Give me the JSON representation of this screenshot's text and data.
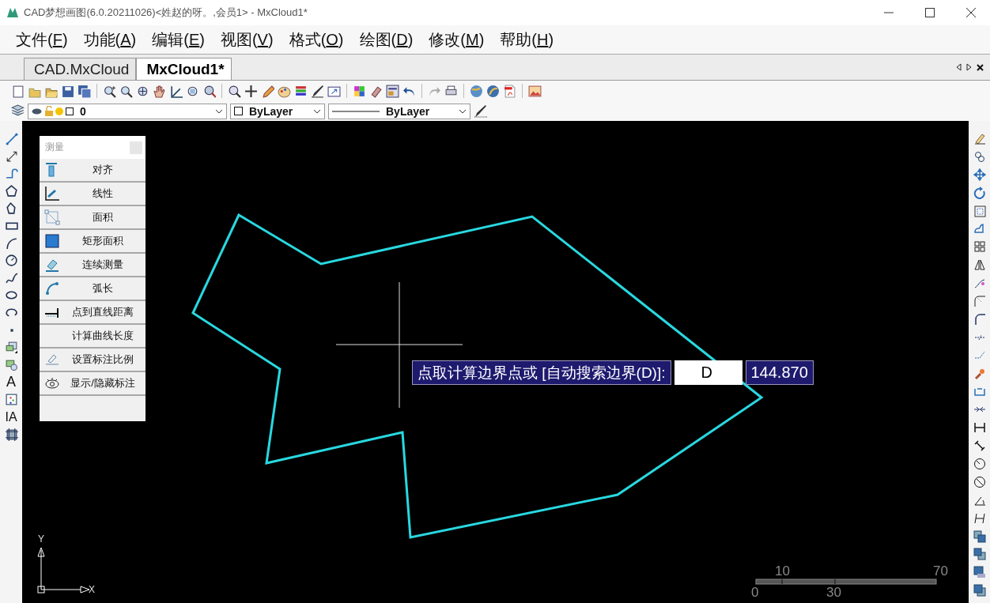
{
  "window": {
    "title": "CAD梦想画图(6.0.20211026)<姓赵的呀。,会员1> - MxCloud1*"
  },
  "menu": [
    {
      "before": "文件(",
      "key": "F",
      "after": ")"
    },
    {
      "before": "功能(",
      "key": "A",
      "after": ")"
    },
    {
      "before": "编辑(",
      "key": "E",
      "after": ")"
    },
    {
      "before": "视图(",
      "key": "V",
      "after": ")"
    },
    {
      "before": "格式(",
      "key": "O",
      "after": ")"
    },
    {
      "before": "绘图(",
      "key": "D",
      "after": ")"
    },
    {
      "before": "修改(",
      "key": "M",
      "after": ")"
    },
    {
      "before": "帮助(",
      "key": "H",
      "after": ")"
    }
  ],
  "tabs": [
    {
      "label": "CAD.MxCloud",
      "selected": false
    },
    {
      "label": "MxCloud1*",
      "selected": true
    }
  ],
  "layer_bar": {
    "layer": "0",
    "color_setting": "ByLayer",
    "linetype": "ByLayer"
  },
  "left_toolbar": {
    "text_tool": "A",
    "mtext_tool": "IA"
  },
  "measure_panel": {
    "title": "测量",
    "items": [
      {
        "label": "对齐",
        "kind": "align"
      },
      {
        "label": "线性",
        "kind": "linear"
      },
      {
        "label": "面积",
        "kind": "area"
      },
      {
        "label": "矩形面积",
        "kind": "rect"
      },
      {
        "label": "连续测量",
        "kind": "continuous"
      },
      {
        "label": "弧长",
        "kind": "arc"
      },
      {
        "label": "点到直线距离",
        "kind": "pointline"
      },
      {
        "label": "计算曲线长度",
        "kind": "curve"
      },
      {
        "label": "设置标注比例",
        "kind": "scale"
      },
      {
        "label": "显示/隐藏标注",
        "kind": "eye"
      }
    ]
  },
  "command": {
    "prompt": "点取计算边界点或 [自动搜索边界(D)]:",
    "input": "D",
    "value": "144.870"
  },
  "axes": {
    "y": "Y",
    "x": "X"
  },
  "scale_bar": {
    "top_labels": [
      "10",
      "70"
    ],
    "bottom_labels": [
      "0",
      "30"
    ]
  }
}
